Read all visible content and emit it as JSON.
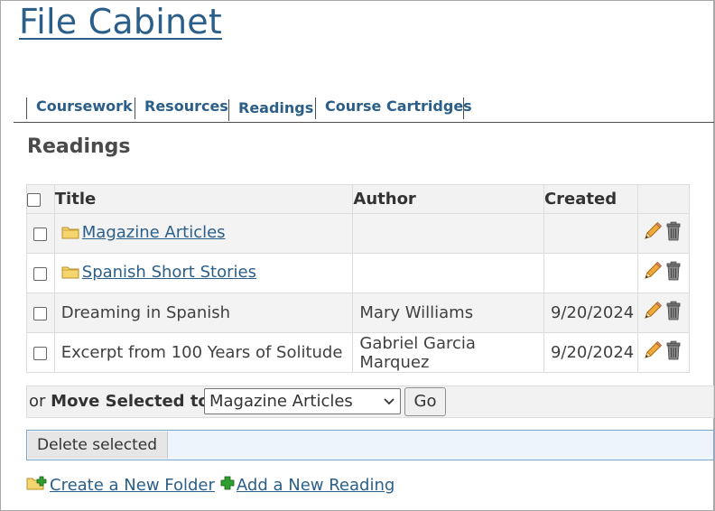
{
  "app": {
    "title": "File Cabinet"
  },
  "tabs": [
    {
      "label": "Coursework",
      "active": false
    },
    {
      "label": "Resources",
      "active": false
    },
    {
      "label": "Readings",
      "active": true
    },
    {
      "label": "Course Cartridges",
      "active": false
    }
  ],
  "section": {
    "title": "Readings"
  },
  "table": {
    "headers": {
      "title": "Title",
      "author": "Author",
      "created": "Created"
    },
    "rows": [
      {
        "type": "folder",
        "title": "Magazine Articles",
        "author": "",
        "created": ""
      },
      {
        "type": "folder",
        "title": "Spanish Short Stories",
        "author": "",
        "created": ""
      },
      {
        "type": "file",
        "title": "Dreaming in Spanish",
        "author": "Mary Williams",
        "created": "9/20/2024"
      },
      {
        "type": "file",
        "title": "Excerpt from 100 Years of Solitude",
        "author": "Gabriel Garcia Marquez",
        "created": "9/20/2024"
      }
    ],
    "row_icons": [
      "pencil-icon",
      "trash-icon"
    ]
  },
  "move": {
    "prefix": "or",
    "label": "Move Selected to:",
    "selected": "Magazine Articles",
    "go_label": "Go"
  },
  "delete": {
    "label": "Delete selected"
  },
  "links": {
    "create_folder": "Create a New Folder",
    "add_reading": "Add a New Reading"
  },
  "colors": {
    "link": "#2b5f8a",
    "folder": "#f5d56e",
    "pencil": "#e8a33a",
    "add": "#2e9e2e"
  }
}
